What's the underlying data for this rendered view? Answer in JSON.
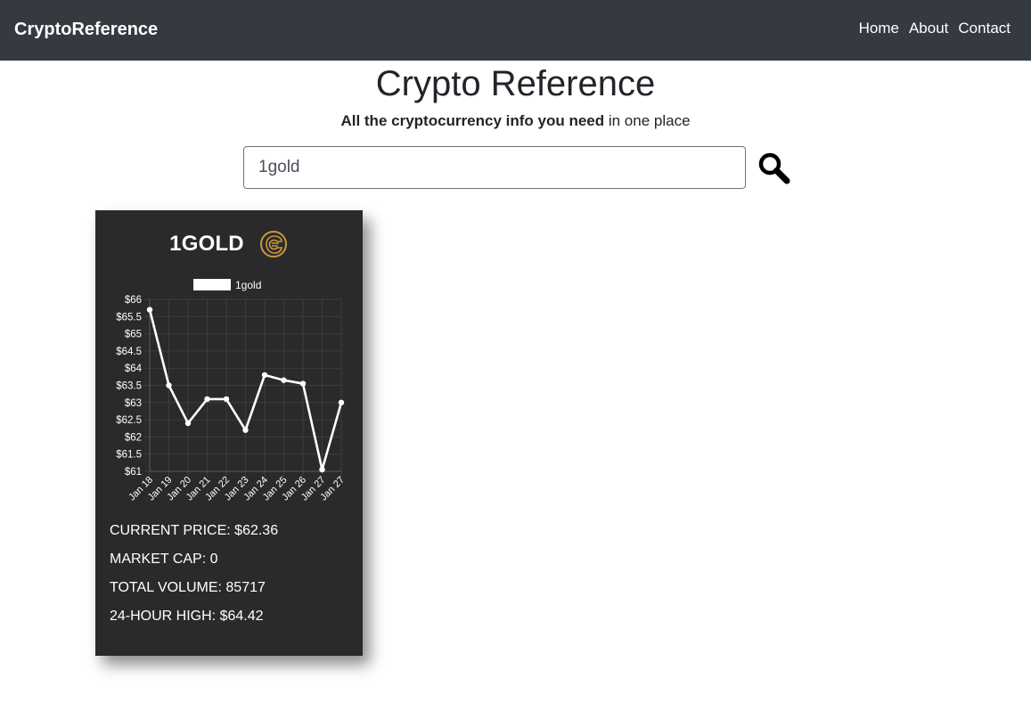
{
  "nav": {
    "brand": "CryptoReference",
    "links": [
      "Home",
      "About",
      "Contact"
    ]
  },
  "header": {
    "title": "Crypto Reference",
    "tagline_bold": "All the cryptocurrency info you need",
    "tagline_rest": " in one place"
  },
  "search": {
    "value": "1gold"
  },
  "card": {
    "coin_name": "1GOLD",
    "logo_icon": "lion-head-coin-icon",
    "stats": [
      "CURRENT PRICE: $62.36",
      "MARKET CAP: 0",
      "TOTAL VOLUME: 85717",
      "24-HOUR HIGH: $64.42"
    ]
  },
  "colors": {
    "navbar": "#343a40",
    "card": "#2a2a2c",
    "logo": "#c9973a"
  },
  "chart_data": {
    "type": "line",
    "categories": [
      "Jan 18",
      "Jan 19",
      "Jan 20",
      "Jan 21",
      "Jan 22",
      "Jan 23",
      "Jan 24",
      "Jan 25",
      "Jan 26",
      "Jan 27",
      "Jan 27"
    ],
    "series": [
      {
        "name": "1gold",
        "values": [
          65.7,
          63.5,
          62.4,
          63.1,
          63.1,
          62.2,
          63.8,
          63.65,
          63.55,
          61.05,
          63.0
        ]
      }
    ],
    "ylim": [
      61,
      66
    ],
    "yticks": [
      "$66",
      "$65.5",
      "$65",
      "$64.5",
      "$64",
      "$63.5",
      "$63",
      "$62.5",
      "$62",
      "$61.5",
      "$61"
    ],
    "grid": true,
    "legend": "top"
  }
}
